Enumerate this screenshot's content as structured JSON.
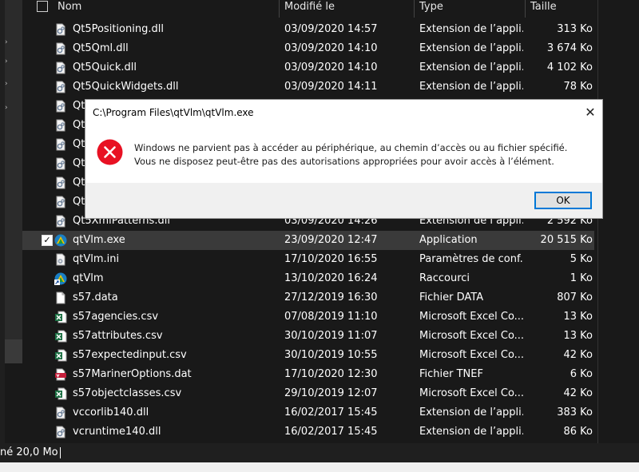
{
  "header": {
    "columns": {
      "name": "Nom",
      "modified": "Modifié le",
      "type": "Type",
      "size": "Taille"
    }
  },
  "files": [
    {
      "name": "Qt5Positioning.dll",
      "modified": "03/09/2020 14:57",
      "type": "Extension de l’appli...",
      "size": "313 Ko",
      "icon": "dll-gear-icon"
    },
    {
      "name": "Qt5Qml.dll",
      "modified": "03/09/2020 14:10",
      "type": "Extension de l’appli...",
      "size": "3 674 Ko",
      "icon": "dll-gear-icon"
    },
    {
      "name": "Qt5Quick.dll",
      "modified": "03/09/2020 14:10",
      "type": "Extension de l’appli...",
      "size": "4 102 Ko",
      "icon": "dll-gear-icon"
    },
    {
      "name": "Qt5QuickWidgets.dll",
      "modified": "03/09/2020 14:11",
      "type": "Extension de l’appli...",
      "size": "78 Ko",
      "icon": "dll-gear-icon"
    },
    {
      "name": "Qt",
      "modified": "",
      "type": "",
      "size": "",
      "icon": "dll-gear-icon"
    },
    {
      "name": "Qt",
      "modified": "",
      "type": "",
      "size": "",
      "icon": "dll-gear-icon"
    },
    {
      "name": "Qt",
      "modified": "",
      "type": "",
      "size": "",
      "icon": "dll-gear-icon"
    },
    {
      "name": "Qt",
      "modified": "",
      "type": "",
      "size": "",
      "icon": "dll-gear-icon"
    },
    {
      "name": "Qt",
      "modified": "",
      "type": "",
      "size": "",
      "icon": "dll-gear-icon"
    },
    {
      "name": "Qt",
      "modified": "",
      "type": "",
      "size": "",
      "icon": "dll-gear-icon"
    },
    {
      "name": "Qt5XmlPatterns.dll",
      "modified": "03/09/2020 14:26",
      "type": "Extension de l’appli...",
      "size": "2 592 Ko",
      "icon": "dll-gear-icon"
    },
    {
      "name": "qtVlm.exe",
      "modified": "23/09/2020 12:47",
      "type": "Application",
      "size": "20 515 Ko",
      "icon": "qtvlm-app-icon",
      "selected": true
    },
    {
      "name": "qtVlm.ini",
      "modified": "17/10/2020 16:55",
      "type": "Paramètres de conf...",
      "size": "5 Ko",
      "icon": "ini-settings-icon"
    },
    {
      "name": "qtVlm",
      "modified": "13/10/2020 16:24",
      "type": "Raccourci",
      "size": "1 Ko",
      "icon": "qtvlm-shortcut-icon"
    },
    {
      "name": "s57.data",
      "modified": "27/12/2019 16:30",
      "type": "Fichier DATA",
      "size": "807 Ko",
      "icon": "blank-file-icon"
    },
    {
      "name": "s57agencies.csv",
      "modified": "07/08/2019 11:10",
      "type": "Microsoft Excel Co...",
      "size": "13 Ko",
      "icon": "excel-csv-icon"
    },
    {
      "name": "s57attributes.csv",
      "modified": "30/10/2019 11:07",
      "type": "Microsoft Excel Co...",
      "size": "13 Ko",
      "icon": "excel-csv-icon"
    },
    {
      "name": "s57expectedinput.csv",
      "modified": "30/10/2019 10:55",
      "type": "Microsoft Excel Co...",
      "size": "42 Ko",
      "icon": "excel-csv-icon"
    },
    {
      "name": "s57MarinerOptions.dat",
      "modified": "17/10/2020 12:30",
      "type": "Fichier TNEF",
      "size": "6 Ko",
      "icon": "vcard-dat-icon"
    },
    {
      "name": "s57objectclasses.csv",
      "modified": "29/10/2019 12:07",
      "type": "Microsoft Excel Co...",
      "size": "42 Ko",
      "icon": "excel-csv-icon"
    },
    {
      "name": "vccorlib140.dll",
      "modified": "16/02/2017 15:45",
      "type": "Extension de l’appli...",
      "size": "383 Ko",
      "icon": "dll-gear-icon"
    },
    {
      "name": "vcruntime140.dll",
      "modified": "16/02/2017 15:45",
      "type": "Extension de l’appli...",
      "size": "86 Ko",
      "icon": "dll-gear-icon"
    }
  ],
  "status": {
    "text": "né  20,0 Mo"
  },
  "dialog": {
    "title": "C:\\Program Files\\qtVlm\\qtVlm.exe",
    "message": "Windows ne parvient pas à accéder au périphérique, au chemin d’accès ou au fichier spécifié. Vous ne disposez peut-être pas des autorisations appropriées pour avoir accès à l’élément.",
    "ok_label": "OK",
    "close_glyph": "✕",
    "error_icon": "error-x-circle-icon"
  },
  "colors": {
    "error_red": "#e81123",
    "accent_blue": "#0078d7",
    "explorer_bg": "#191919",
    "selected_row": "#3a3a3a"
  }
}
